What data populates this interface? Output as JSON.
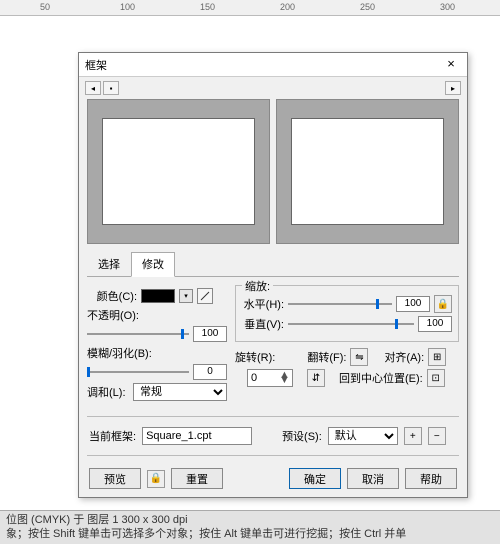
{
  "ruler": {
    "t50": "50",
    "t100": "100",
    "t150": "150",
    "t200": "200",
    "t250": "250",
    "t300": "300"
  },
  "dialog": {
    "title": "框架",
    "tabs": {
      "select": "选择",
      "modify": "修改"
    },
    "color": {
      "label": "颜色(C):"
    },
    "opacity": {
      "label": "不透明(O):",
      "value": "100"
    },
    "blur": {
      "label": "模糊/羽化(B):",
      "value": "0"
    },
    "blend": {
      "label": "调和(L):",
      "value": "常规"
    },
    "scale": {
      "group": "缩放:",
      "h_label": "水平(H):",
      "h_value": "100",
      "v_label": "垂直(V):",
      "v_value": "100"
    },
    "rotate": {
      "label": "旋转(R):",
      "value": "0"
    },
    "flip": {
      "label": "翻转(F):"
    },
    "align": {
      "label": "对齐(A):"
    },
    "recenter": {
      "label": "回到中心位置(E):"
    },
    "current": {
      "label": "当前框架:",
      "value": "Square_1.cpt"
    },
    "preset": {
      "label": "预设(S):",
      "value": "默认"
    },
    "buttons": {
      "preview": "预览",
      "reset": "重置",
      "ok": "确定",
      "cancel": "取消",
      "help": "帮助"
    }
  },
  "status": {
    "line1": "位图 (CMYK) 于 图层 1 300 x 300 dpi",
    "line2": "象；按住 Shift 键单击可选择多个对象；按住 Alt 键单击可进行挖掘；按住 Ctrl 并单"
  }
}
